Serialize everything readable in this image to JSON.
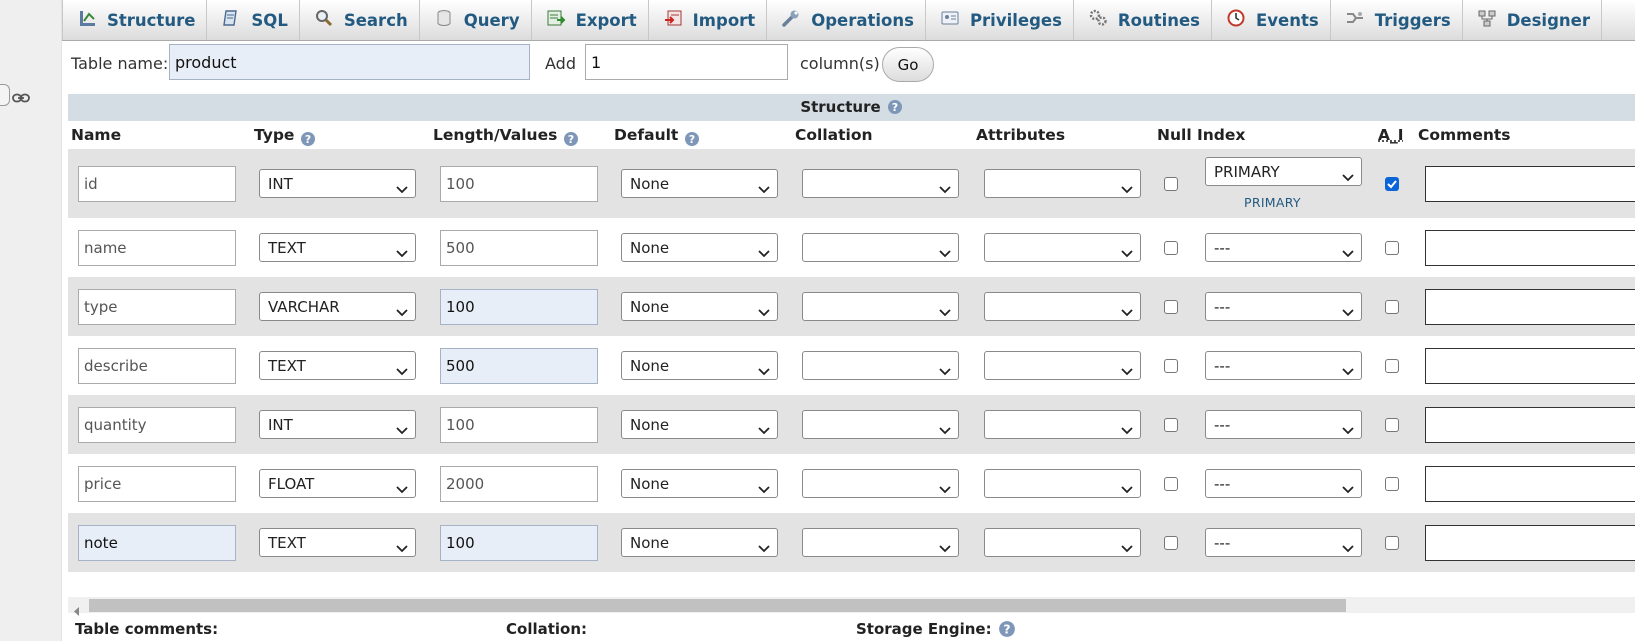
{
  "tabs": [
    {
      "label": "Structure",
      "icon": "structure-icon"
    },
    {
      "label": "SQL",
      "icon": "sql-icon"
    },
    {
      "label": "Search",
      "icon": "search-icon"
    },
    {
      "label": "Query",
      "icon": "query-icon"
    },
    {
      "label": "Export",
      "icon": "export-icon"
    },
    {
      "label": "Import",
      "icon": "import-icon"
    },
    {
      "label": "Operations",
      "icon": "wrench-icon"
    },
    {
      "label": "Privileges",
      "icon": "privileges-icon"
    },
    {
      "label": "Routines",
      "icon": "routines-icon"
    },
    {
      "label": "Events",
      "icon": "clock-icon"
    },
    {
      "label": "Triggers",
      "icon": "triggers-icon"
    },
    {
      "label": "Designer",
      "icon": "designer-icon"
    }
  ],
  "table_name": {
    "label": "Table name:",
    "value": "product"
  },
  "add_columns": {
    "label": "Add",
    "value": "1",
    "suffix": "column(s)",
    "go": "Go"
  },
  "structure": {
    "caption": "Structure",
    "headers": {
      "name": "Name",
      "type": "Type",
      "length": "Length/Values",
      "default": "Default",
      "collation": "Collation",
      "attributes": "Attributes",
      "null": "Null",
      "index": "Index",
      "ai": "A_I",
      "comments": "Comments"
    },
    "rows": [
      {
        "name": "id",
        "type": "INT",
        "length": "100",
        "default": "None",
        "collation": "",
        "attributes": "",
        "null": false,
        "index": "PRIMARY",
        "index_link": "PRIMARY",
        "ai": true
      },
      {
        "name": "name",
        "type": "TEXT",
        "length": "500",
        "default": "None",
        "collation": "",
        "attributes": "",
        "null": false,
        "index": "---",
        "ai": false
      },
      {
        "name": "type",
        "type": "VARCHAR",
        "length": "100",
        "default": "None",
        "collation": "",
        "attributes": "",
        "null": false,
        "index": "---",
        "ai": false
      },
      {
        "name": "describe",
        "type": "TEXT",
        "length": "500",
        "default": "None",
        "collation": "",
        "attributes": "",
        "null": false,
        "index": "---",
        "ai": false
      },
      {
        "name": "quantity",
        "type": "INT",
        "length": "100",
        "default": "None",
        "collation": "",
        "attributes": "",
        "null": false,
        "index": "---",
        "ai": false
      },
      {
        "name": "price",
        "type": "FLOAT",
        "length": "2000",
        "default": "None",
        "collation": "",
        "attributes": "",
        "null": false,
        "index": "---",
        "ai": false
      },
      {
        "name": "note",
        "type": "TEXT",
        "length": "100",
        "default": "None",
        "collation": "",
        "attributes": "",
        "null": false,
        "index": "---",
        "ai": false
      }
    ]
  },
  "footer": {
    "table_comments": "Table comments:",
    "collation": "Collation:",
    "storage_engine": "Storage Engine:"
  },
  "colors": {
    "link_blue": "#235a81",
    "caption_bg": "#d4dde4",
    "odd_row_bg": "#e3e3e3",
    "checked": "#0a65d8"
  }
}
